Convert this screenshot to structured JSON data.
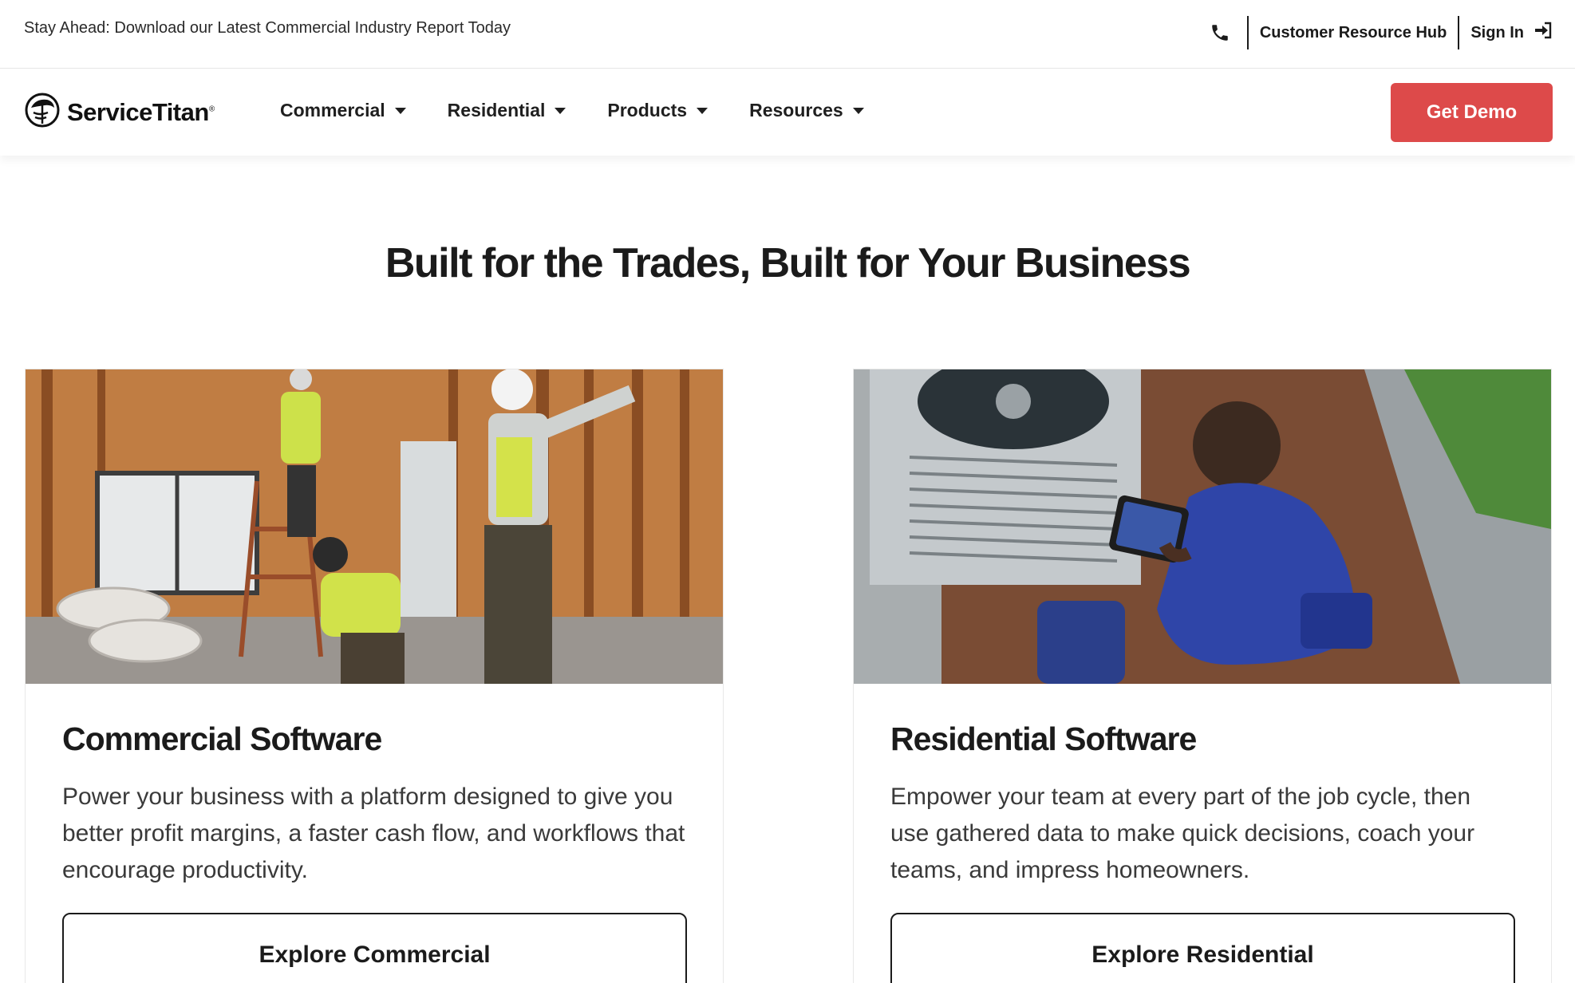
{
  "topbar": {
    "promo_text": "Stay Ahead: Download our Latest Commercial Industry Report Today",
    "phone_icon": "phone-icon",
    "customer_hub_label": "Customer Resource Hub",
    "sign_in_label": "Sign In",
    "sign_in_icon": "sign-in-icon"
  },
  "nav": {
    "logo_text": "ServiceTitan",
    "logo_mark": "®",
    "items": [
      {
        "label": "Commercial"
      },
      {
        "label": "Residential"
      },
      {
        "label": "Products"
      },
      {
        "label": "Resources"
      }
    ],
    "cta_label": "Get Demo",
    "cta_color": "#dd4a4a"
  },
  "main": {
    "headline": "Built for the Trades, Built for Your Business",
    "cards": [
      {
        "image": "commercial-construction-workers-photo",
        "title": "Commercial Software",
        "description": "Power your business with a platform designed to give you better profit margins, a faster cash flow, and workflows that encourage productivity.",
        "button_label": "Explore Commercial"
      },
      {
        "image": "hvac-technician-tablet-photo",
        "title": "Residential Software",
        "description": "Empower your team at every part of the job cycle, then use gathered data to make quick decisions, coach your teams, and impress homeowners.",
        "button_label": "Explore Residential"
      }
    ]
  }
}
